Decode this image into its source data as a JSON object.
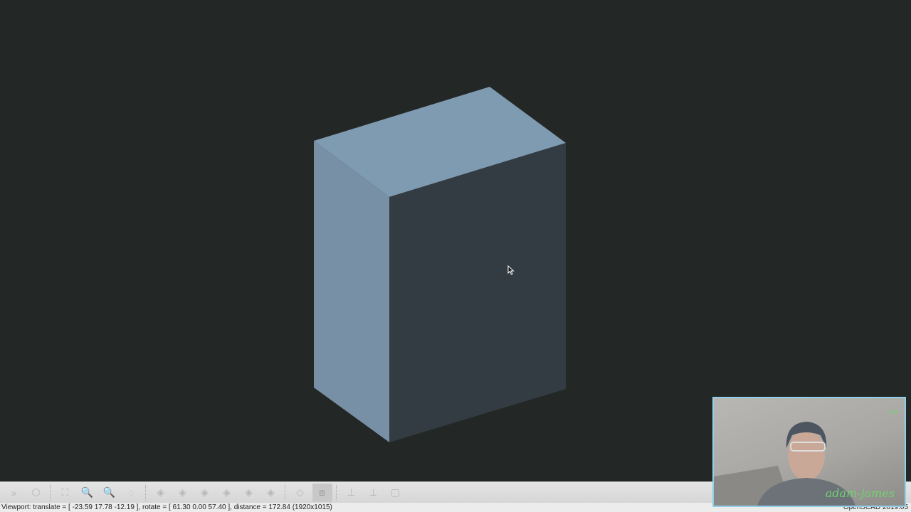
{
  "viewport": {
    "background": "#232726",
    "model_colors": {
      "top": "#7f9bb1",
      "left": "#7890a5",
      "front": "#343c43"
    }
  },
  "toolbar": {
    "buttons": [
      {
        "name": "render-preview",
        "icon": "»"
      },
      {
        "name": "render",
        "icon": "⬡"
      },
      {
        "name": "view-all",
        "icon": "⛶"
      },
      {
        "name": "zoom-in",
        "icon": "🔍"
      },
      {
        "name": "zoom-out",
        "icon": "🔍"
      },
      {
        "name": "reset-view",
        "icon": "◌"
      },
      {
        "name": "view-right",
        "icon": "◈"
      },
      {
        "name": "view-top",
        "icon": "◈"
      },
      {
        "name": "view-bottom",
        "icon": "◈"
      },
      {
        "name": "view-left",
        "icon": "◈"
      },
      {
        "name": "view-front",
        "icon": "◈"
      },
      {
        "name": "view-back",
        "icon": "◈"
      },
      {
        "name": "perspective",
        "icon": "◇"
      },
      {
        "name": "orthogonal",
        "icon": "⧈"
      },
      {
        "name": "show-axes",
        "icon": "⊥"
      },
      {
        "name": "show-scale-markers",
        "icon": "⟂"
      },
      {
        "name": "show-edges",
        "icon": "▢"
      }
    ]
  },
  "status": {
    "text": "Viewport: translate = [ -23.59 17.78 -12.19 ], rotate = [ 61.30 0.00 57.40 ], distance = 172.84 (1920x1015)",
    "right": "OpenSCAD 2019.05"
  },
  "webcam": {
    "name": "adam-james",
    "logo": "ت"
  }
}
